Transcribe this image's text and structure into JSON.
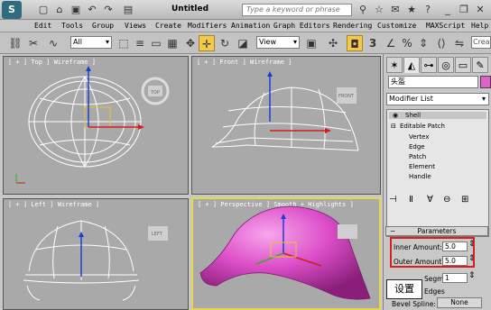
{
  "window": {
    "logo": "S",
    "title": "Untitled",
    "search_placeholder": "Type a keyword or phrase"
  },
  "menu": [
    "Edit",
    "Tools",
    "Group",
    "Views",
    "Create",
    "Modifiers",
    "Animation",
    "Graph Editors",
    "Rendering",
    "Customize",
    "MAXScript",
    "Help"
  ],
  "toolbar": {
    "selection_filter": "All",
    "ref_coord": "View",
    "create_sel": "Create"
  },
  "viewports": {
    "top": {
      "label": "[ + ] Top ] Wireframe ]",
      "cube": "TOP"
    },
    "front": {
      "label": "[ + ] Front ] Wireframe ]",
      "cube": "FRONT"
    },
    "left": {
      "label": "[ + ] Left ] Wireframe ]",
      "cube": "LEFT"
    },
    "perspective": {
      "label": "[ + ] Perspective ] Smooth + Highlights ]"
    }
  },
  "command_panel": {
    "object_name": "头盔",
    "object_color": "#e05fc8",
    "modifier_list": "Modifier List",
    "stack": [
      "Shell",
      "Editable Patch",
      "Vertex",
      "Edge",
      "Patch",
      "Element",
      "Handle"
    ],
    "rollout": "Parameters",
    "inner_label": "Inner Amount:",
    "inner_value": "5.0",
    "outer_label": "Outer Amount:",
    "outer_value": "5.0",
    "segments_label": "Segments:",
    "segments_value": "1",
    "edges_label": "Edges",
    "bevel_label": "Bevel Spline:",
    "bevel_value": "None"
  },
  "callout": "设置",
  "colors": {
    "accent": "#f1c94f",
    "highlight": "#d32020",
    "object": "#e05fc8"
  }
}
